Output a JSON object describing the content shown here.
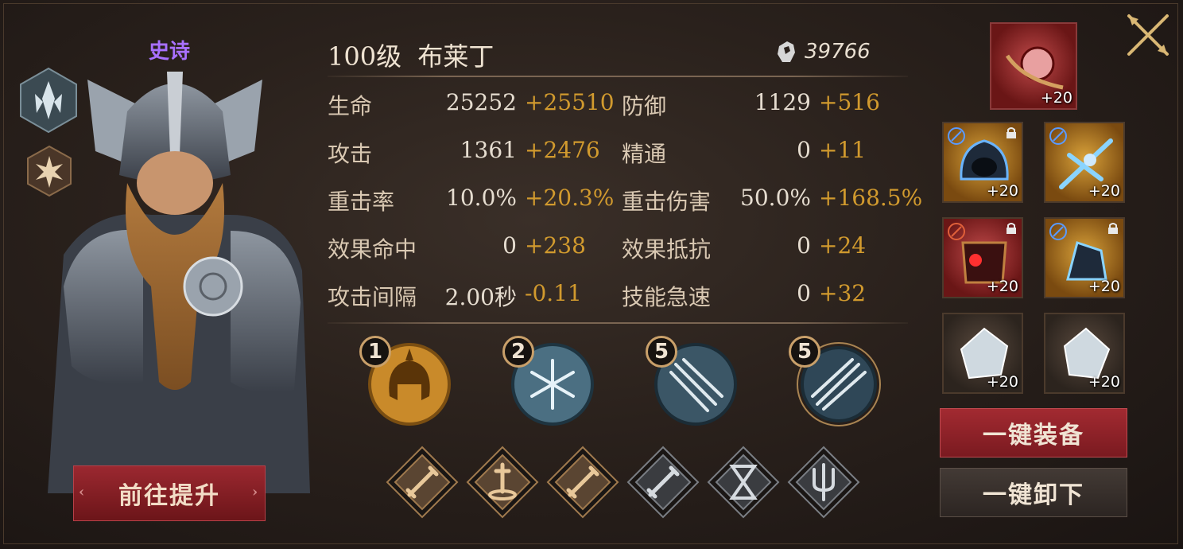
{
  "hero": {
    "rarity": "史诗",
    "title": "100级  布莱丁",
    "power": "39766",
    "upgrade_label": "前往提升"
  },
  "stats": [
    {
      "label": "生命",
      "base": "25252",
      "bonus": "+25510"
    },
    {
      "label": "防御",
      "base": "1129",
      "bonus": "+516"
    },
    {
      "label": "攻击",
      "base": "1361",
      "bonus": "+2476"
    },
    {
      "label": "精通",
      "base": "0",
      "bonus": "+11"
    },
    {
      "label": "重击率",
      "base": "10.0%",
      "bonus": "+20.3%"
    },
    {
      "label": "重击伤害",
      "base": "50.0%",
      "bonus": "+168.5%"
    },
    {
      "label": "效果命中",
      "base": "0",
      "bonus": "+238"
    },
    {
      "label": "效果抵抗",
      "base": "0",
      "bonus": "+24"
    },
    {
      "label": "攻击间隔",
      "base": "2.00秒",
      "bonus": "-0.11"
    },
    {
      "label": "技能急速",
      "base": "0",
      "bonus": "+32"
    }
  ],
  "skills": [
    {
      "level": "1",
      "icon": "spartan-helmet-flame-icon",
      "color": "#c98a2a"
    },
    {
      "level": "2",
      "icon": "snowflake-icon",
      "color": "#4b6f82"
    },
    {
      "level": "5",
      "icon": "triple-arrow-icon",
      "color": "#3b5666"
    },
    {
      "level": "5",
      "icon": "arrow-volley-icon",
      "color": "#2f4757"
    }
  ],
  "talents": [
    {
      "icon": "sword-icon",
      "active": true
    },
    {
      "icon": "sword-in-stone-icon",
      "active": true
    },
    {
      "icon": "sword-icon",
      "active": true
    },
    {
      "icon": "sword-icon",
      "active": false
    },
    {
      "icon": "hourglass-icon",
      "active": false
    },
    {
      "icon": "trident-icon",
      "active": false
    }
  ],
  "equipment": {
    "artifact": {
      "icon": "crimson-orb-relic-icon",
      "level": "+20"
    },
    "slots": [
      {
        "icon": "hooded-helm-icon",
        "level": "+20",
        "locked": true,
        "mark": "blue"
      },
      {
        "icon": "crystal-crossbow-icon",
        "level": "+20",
        "locked": false,
        "mark": "blue"
      },
      {
        "icon": "crimson-chest-armor-icon",
        "level": "+20",
        "locked": true,
        "mark": "red"
      },
      {
        "icon": "crystal-gauntlet-icon",
        "level": "+20",
        "locked": true,
        "mark": "blue"
      },
      {
        "icon": "ice-crystal-ring-icon",
        "level": "+20",
        "locked": false,
        "mark": ""
      },
      {
        "icon": "ice-crystal-amulet-icon",
        "level": "+20",
        "locked": false,
        "mark": ""
      }
    ]
  },
  "actions": {
    "equip_all": "一键装备",
    "unequip_all": "一键卸下"
  },
  "colors": {
    "rarity": "#a870ff",
    "bonus": "#d19a2e",
    "accent_red": "#9b2830"
  }
}
